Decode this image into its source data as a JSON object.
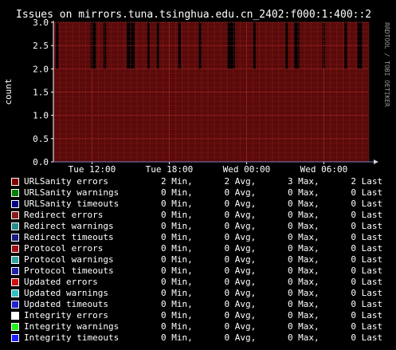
{
  "chart_data": {
    "type": "area",
    "title": "Issues on mirrors.tuna.tsinghua.edu.cn_2402:f000:1:400::2",
    "ylabel": "count",
    "watermark": "RRDTOOL / TOBI OETIKER",
    "ylim": [
      0,
      3.0
    ],
    "y_ticks": [
      "3.0",
      "2.5",
      "2.0",
      "1.5",
      "1.0",
      "0.5",
      "0.0"
    ],
    "y_tick_values": [
      3.0,
      2.5,
      2.0,
      1.5,
      1.0,
      0.5,
      0.0
    ],
    "x_tick_labels": [
      "Tue 12:00",
      "Tue 18:00",
      "Wed 00:00",
      "Wed 06:00"
    ],
    "x_range_hours": [
      9,
      33.5
    ],
    "x_tick_hours": [
      12,
      18,
      24,
      30
    ],
    "grid": true,
    "colors": {
      "background": "#000000",
      "area": "#5a0a0a",
      "grid": "#8a1f1f",
      "axis": "#ffffff",
      "arrow": "#d0d0d0"
    },
    "series": [
      {
        "name": "URLSanity errors",
        "dips_to_2_hours": [
          [
            9.2,
            9.4
          ],
          [
            11.9,
            12.3
          ],
          [
            12.9,
            13.1
          ],
          [
            14.7,
            15.3
          ],
          [
            16.3,
            16.5
          ],
          [
            17.0,
            17.2
          ],
          [
            18.7,
            18.9
          ],
          [
            20.3,
            20.5
          ],
          [
            22.5,
            23.1
          ],
          [
            24.5,
            24.7
          ],
          [
            27.0,
            27.2
          ],
          [
            27.7,
            28.1
          ],
          [
            29.9,
            30.1
          ],
          [
            31.6,
            31.8
          ],
          [
            32.6,
            33.0
          ]
        ],
        "max": 3,
        "min": 2
      }
    ],
    "legend": [
      {
        "label": "URLSanity errors",
        "color": "#800000",
        "stats": "2 Min,      2 Avg,      3 Max,      2 Last"
      },
      {
        "label": "URLSanity warnings",
        "color": "#008000",
        "stats": "0 Min,      0 Avg,      0 Max,      0 Last"
      },
      {
        "label": "URLSanity timeouts",
        "color": "#000080",
        "stats": "0 Min,      0 Avg,      0 Max,      0 Last"
      },
      {
        "label": "Redirect errors",
        "color": "#8a1a1a",
        "stats": "0 Min,      0 Avg,      0 Max,      0 Last"
      },
      {
        "label": "Redirect warnings",
        "color": "#2a8a8a",
        "stats": "0 Min,      0 Avg,      0 Max,      0 Last"
      },
      {
        "label": "Redirect timeouts",
        "color": "#1a1a80",
        "stats": "0 Min,      0 Avg,      0 Max,      0 Last"
      },
      {
        "label": "Protocol errors",
        "color": "#a01010",
        "stats": "0 Min,      0 Avg,      0 Max,      0 Last"
      },
      {
        "label": "Protocol warnings",
        "color": "#30a0a0",
        "stats": "0 Min,      0 Avg,      0 Max,      0 Last"
      },
      {
        "label": "Protocol timeouts",
        "color": "#2020a0",
        "stats": "0 Min,      0 Avg,      0 Max,      0 Last"
      },
      {
        "label": "Updated errors",
        "color": "#d01010",
        "stats": "0 Min,      0 Avg,      0 Max,      0 Last"
      },
      {
        "label": "Updated warnings",
        "color": "#30c0c0",
        "stats": "0 Min,      0 Avg,      0 Max,      0 Last"
      },
      {
        "label": "Updated timeouts",
        "color": "#2020d0",
        "stats": "0 Min,      0 Avg,      0 Max,      0 Last"
      },
      {
        "label": "Integrity errors",
        "color": "#ffffff",
        "stats": "0 Min,      0 Avg,      0 Max,      0 Last"
      },
      {
        "label": "Integrity warnings",
        "color": "#20f020",
        "stats": "0 Min,      0 Avg,      0 Max,      0 Last"
      },
      {
        "label": "Integrity timeouts",
        "color": "#2020ff",
        "stats": "0 Min,      0 Avg,      0 Max,      0 Last"
      }
    ]
  }
}
